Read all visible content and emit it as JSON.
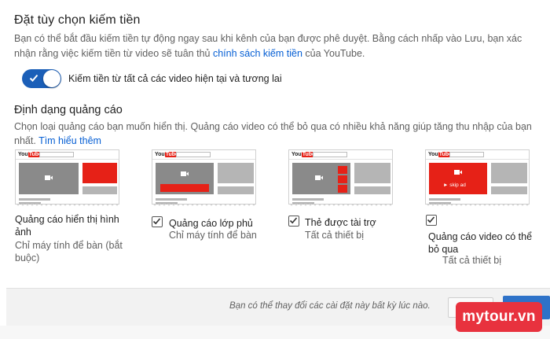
{
  "monetization": {
    "title": "Đặt tùy chọn kiếm tiền",
    "desc_part1": "Bạn có thể bắt đầu kiếm tiền tự động ngay sau khi kênh của bạn được phê duyệt. Bằng cách nhấp vào Lưu, bạn xác nhận rằng việc kiếm tiền từ video sẽ tuân thủ ",
    "policy_link": "chính sách kiếm tiền",
    "desc_part2": " của YouTube.",
    "toggle_label": "Kiếm tiền từ tất cả các video hiện tại và tương lai",
    "toggle_on": true
  },
  "ad_formats": {
    "title": "Định dạng quảng cáo",
    "desc": "Chọn loại quảng cáo bạn muốn hiển thị. Quảng cáo video có thể bỏ qua có nhiều khả năng giúp tăng thu nhập của bạn nhất. ",
    "learn_more": "Tìm hiểu thêm",
    "thumb_logo": "You",
    "thumb_logo_tube": "Tube",
    "skip_label": "► skip ad",
    "options": [
      {
        "title_line1": "Quảng cáo hiển thị hình",
        "title_line2": "ảnh",
        "sub_line1": "Chỉ máy tính để bàn (bắt",
        "sub_line2": "buộc)",
        "checked": true
      },
      {
        "title": "Quảng cáo lớp phủ",
        "sub": "Chỉ máy tính để bàn",
        "checked": true
      },
      {
        "title": "Thẻ được tài trợ",
        "sub": "Tất cả thiết bị",
        "checked": true
      },
      {
        "title_line1": "Quảng cáo video có thể",
        "title_line2": "bỏ qua",
        "sub": "Tất cả thiết bị",
        "checked": true
      }
    ]
  },
  "footer": {
    "note": "Bạn có thể thay đổi các cài đặt này bất kỳ lúc nào."
  },
  "watermark": "mytour.vn",
  "colors": {
    "accent": "#065fd4",
    "toggle": "#1b5fb8",
    "ad_red": "#e62117",
    "save": "#2e72c8",
    "watermark": "#e8323e"
  }
}
